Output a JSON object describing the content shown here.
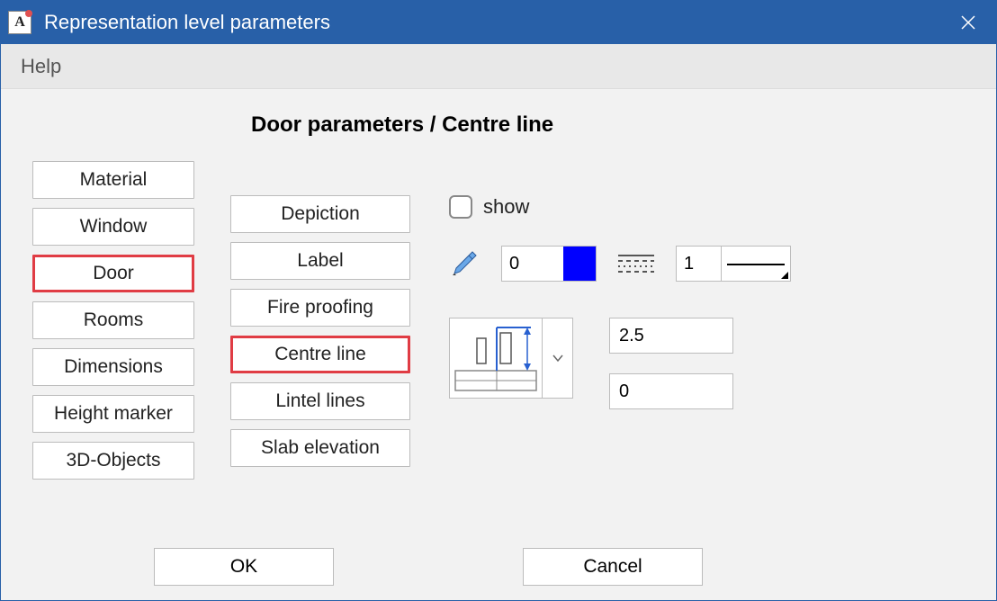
{
  "window": {
    "title": "Representation level parameters",
    "app_icon_letter": "A"
  },
  "menubar": {
    "help_label": "Help"
  },
  "page": {
    "title": "Door parameters / Centre line"
  },
  "categories": [
    {
      "label": "Material",
      "highlighted": false
    },
    {
      "label": "Window",
      "highlighted": false
    },
    {
      "label": "Door",
      "highlighted": true
    },
    {
      "label": "Rooms",
      "highlighted": false
    },
    {
      "label": "Dimensions",
      "highlighted": false
    },
    {
      "label": "Height marker",
      "highlighted": false
    },
    {
      "label": "3D-Objects",
      "highlighted": false
    }
  ],
  "subsections": [
    {
      "label": "Depiction",
      "highlighted": false
    },
    {
      "label": "Label",
      "highlighted": false
    },
    {
      "label": "Fire proofing",
      "highlighted": false
    },
    {
      "label": "Centre line",
      "highlighted": true
    },
    {
      "label": "Lintel lines",
      "highlighted": false
    },
    {
      "label": "Slab elevation",
      "highlighted": false
    }
  ],
  "settings": {
    "show_label": "show",
    "show_checked": false,
    "pen_value": "0",
    "pen_color": "#0000ff",
    "linestyle_value": "1",
    "offset_top": "2.5",
    "offset_bottom": "0"
  },
  "footer": {
    "ok_label": "OK",
    "cancel_label": "Cancel"
  }
}
